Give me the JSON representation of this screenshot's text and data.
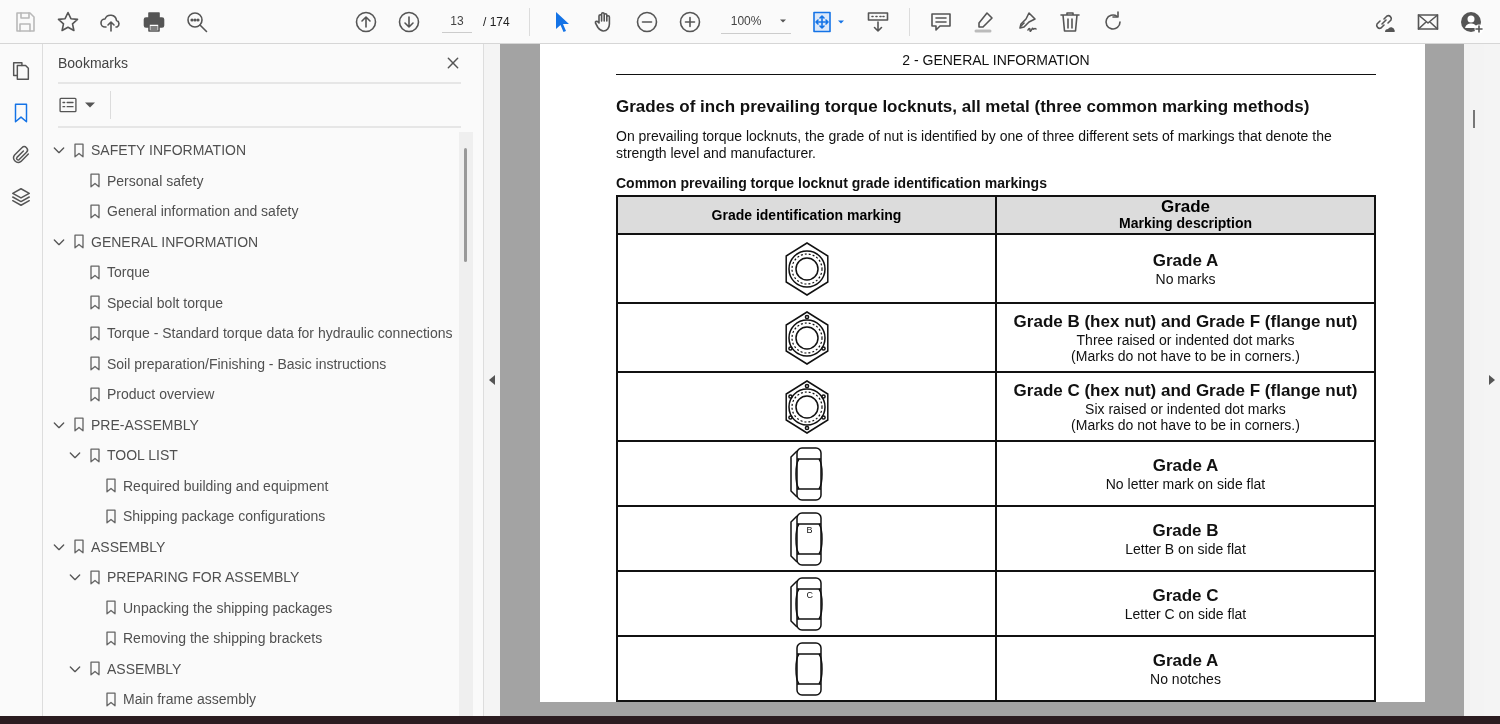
{
  "toolbar": {
    "save": {
      "disabled": true
    },
    "page_field": {
      "value": "13"
    },
    "page_total": "/ 174",
    "tools": [
      {
        "selected": true
      },
      {
        "selected": false
      }
    ],
    "zoom_field": {
      "value": "100%"
    }
  },
  "rail": [
    {
      "selected": false
    },
    {
      "selected": true
    },
    {
      "selected": false
    },
    {
      "selected": false
    }
  ],
  "bookmarks": {
    "title": "Bookmarks",
    "items": [
      {
        "label": "SAFETY INFORMATION",
        "expanded": true,
        "children": [
          {
            "label": "Personal safety"
          },
          {
            "label": "General information and safety"
          }
        ]
      },
      {
        "label": "GENERAL INFORMATION",
        "expanded": true,
        "children": [
          {
            "label": "Torque"
          },
          {
            "label": "Special bolt torque"
          },
          {
            "label": "Torque - Standard torque data for hydraulic connections"
          },
          {
            "label": "Soil preparation/Finishing - Basic instructions"
          },
          {
            "label": "Product overview"
          }
        ]
      },
      {
        "label": "PRE-ASSEMBLY",
        "expanded": true,
        "children": [
          {
            "label": "TOOL LIST",
            "expanded": true,
            "children": [
              {
                "label": "Required building and equipment"
              },
              {
                "label": "Shipping package configurations"
              }
            ]
          }
        ]
      },
      {
        "label": "ASSEMBLY",
        "expanded": true,
        "children": [
          {
            "label": "PREPARING FOR ASSEMBLY",
            "expanded": true,
            "children": [
              {
                "label": "Unpacking the shipping packages"
              },
              {
                "label": "Removing the shipping brackets"
              }
            ]
          },
          {
            "label": "ASSEMBLY",
            "expanded": true,
            "children": [
              {
                "label": "Main frame assembly"
              }
            ]
          }
        ]
      }
    ]
  },
  "document": {
    "header": "2 - GENERAL INFORMATION",
    "heading": "Grades of inch prevailing torque locknuts, all metal (three common marking methods)",
    "paragraph": "On prevailing torque locknuts, the grade of nut is identified by one of three different sets of markings that denote the strength level and manufacturer.",
    "table": {
      "caption": "Common prevailing torque locknut grade identification markings",
      "columns": [
        {
          "title": "Grade identification marking"
        },
        {
          "title": "Grade",
          "subtitle": "Marking description"
        }
      ],
      "rows": [
        {
          "marking": {
            "kind": "hex"
          },
          "grade": "Grade A",
          "description": [
            "No marks"
          ]
        },
        {
          "marking": {
            "kind": "hex-three-dots"
          },
          "grade": "Grade B (hex nut) and Grade F (flange nut)",
          "description": [
            "Three raised or indented dot marks",
            "(Marks do not have to be in corners.)"
          ]
        },
        {
          "marking": {
            "kind": "hex-six-dots"
          },
          "grade": "Grade C (hex nut) and Grade F (flange nut)",
          "description": [
            "Six raised or indented dot marks",
            "(Marks do not have to be in corners.)"
          ]
        },
        {
          "marking": {
            "kind": "side"
          },
          "grade": "Grade A",
          "description": [
            "No letter mark on side flat"
          ]
        },
        {
          "marking": {
            "kind": "side",
            "letter": "B"
          },
          "grade": "Grade B",
          "description": [
            "Letter B on side flat"
          ]
        },
        {
          "marking": {
            "kind": "side",
            "letter": "C"
          },
          "grade": "Grade C",
          "description": [
            "Letter C on side flat"
          ]
        },
        {
          "marking": {
            "kind": "side-plain"
          },
          "grade": "Grade A",
          "description": [
            "No notches"
          ]
        }
      ]
    }
  }
}
